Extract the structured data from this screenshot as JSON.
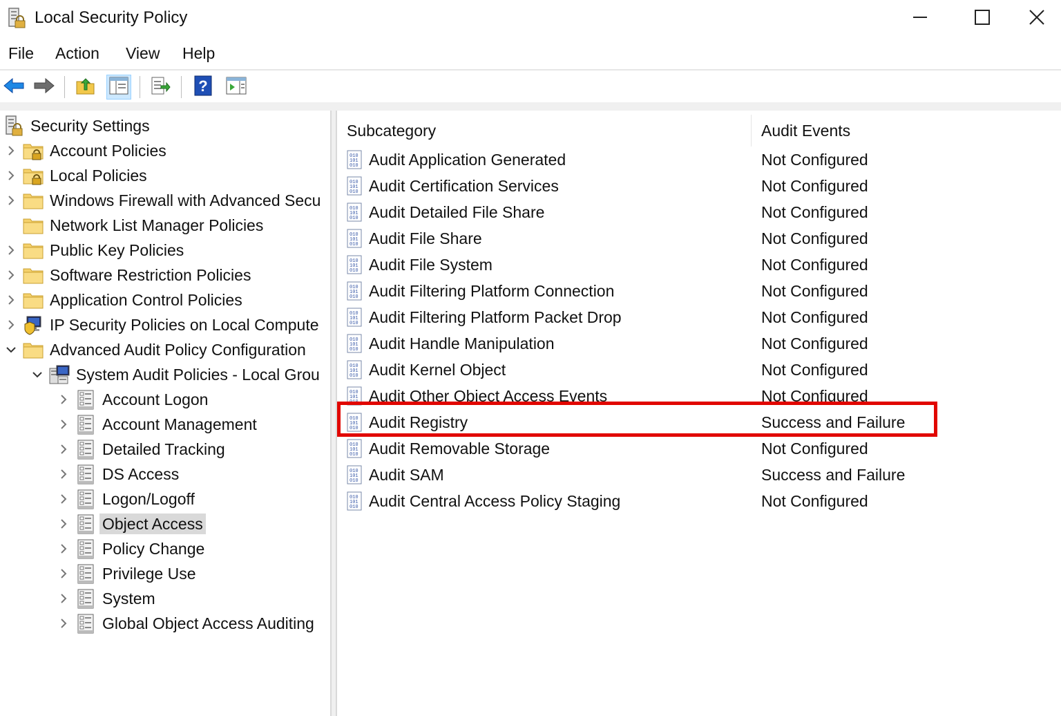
{
  "window": {
    "title": "Local Security Policy"
  },
  "menu": [
    "File",
    "Action",
    "View",
    "Help"
  ],
  "toolbar": {
    "buttons": [
      "back-arrow-icon",
      "forward-arrow-icon",
      "up-folder-icon",
      "show-hide-console-tree-icon",
      "export-list-icon",
      "help-icon",
      "show-hide-action-pane-icon"
    ]
  },
  "tree": {
    "root": "Security Settings",
    "items": [
      {
        "label": "Account Policies",
        "expander": "collapsed",
        "icon": "lock-folder-icon"
      },
      {
        "label": "Local Policies",
        "expander": "collapsed",
        "icon": "lock-folder-icon"
      },
      {
        "label": "Windows Firewall with Advanced Secu",
        "expander": "collapsed",
        "icon": "folder-icon"
      },
      {
        "label": "Network List Manager Policies",
        "expander": "none",
        "icon": "folder-icon"
      },
      {
        "label": "Public Key Policies",
        "expander": "collapsed",
        "icon": "folder-icon"
      },
      {
        "label": "Software Restriction Policies",
        "expander": "collapsed",
        "icon": "folder-icon"
      },
      {
        "label": "Application Control Policies",
        "expander": "collapsed",
        "icon": "folder-icon"
      },
      {
        "label": "IP Security Policies on Local Compute",
        "expander": "collapsed",
        "icon": "ip-security-icon"
      },
      {
        "label": "Advanced Audit Policy Configuration",
        "expander": "expanded",
        "icon": "folder-icon"
      }
    ],
    "system_audit": {
      "label": "System Audit Policies - Local Grou",
      "expander": "expanded"
    },
    "audit_categories": [
      {
        "label": "Account Logon",
        "selected": false
      },
      {
        "label": "Account Management",
        "selected": false
      },
      {
        "label": "Detailed Tracking",
        "selected": false
      },
      {
        "label": "DS Access",
        "selected": false
      },
      {
        "label": "Logon/Logoff",
        "selected": false
      },
      {
        "label": "Object Access",
        "selected": true
      },
      {
        "label": "Policy Change",
        "selected": false
      },
      {
        "label": "Privilege Use",
        "selected": false
      },
      {
        "label": "System",
        "selected": false
      },
      {
        "label": "Global Object Access Auditing",
        "selected": false
      }
    ]
  },
  "list": {
    "columns": [
      "Subcategory",
      "Audit Events"
    ],
    "rows": [
      {
        "subcategory": "Audit Application Generated",
        "audit_events": "Not Configured"
      },
      {
        "subcategory": "Audit Certification Services",
        "audit_events": "Not Configured"
      },
      {
        "subcategory": "Audit Detailed File Share",
        "audit_events": "Not Configured"
      },
      {
        "subcategory": "Audit File Share",
        "audit_events": "Not Configured"
      },
      {
        "subcategory": "Audit File System",
        "audit_events": "Not Configured"
      },
      {
        "subcategory": "Audit Filtering Platform Connection",
        "audit_events": "Not Configured"
      },
      {
        "subcategory": "Audit Filtering Platform Packet Drop",
        "audit_events": "Not Configured"
      },
      {
        "subcategory": "Audit Handle Manipulation",
        "audit_events": "Not Configured"
      },
      {
        "subcategory": "Audit Kernel Object",
        "audit_events": "Not Configured"
      },
      {
        "subcategory": "Audit Other Object Access Events",
        "audit_events": "Not Configured"
      },
      {
        "subcategory": "Audit Registry",
        "audit_events": "Success and Failure"
      },
      {
        "subcategory": "Audit Removable Storage",
        "audit_events": "Not Configured"
      },
      {
        "subcategory": "Audit SAM",
        "audit_events": "Success and Failure"
      },
      {
        "subcategory": "Audit Central Access Policy Staging",
        "audit_events": "Not Configured"
      }
    ],
    "highlighted_row": "Audit Registry"
  },
  "colors": {
    "highlight_border": "#e10600",
    "selection_bg": "#d9d9d9",
    "toolbar_active_bg": "#cce8ff"
  }
}
